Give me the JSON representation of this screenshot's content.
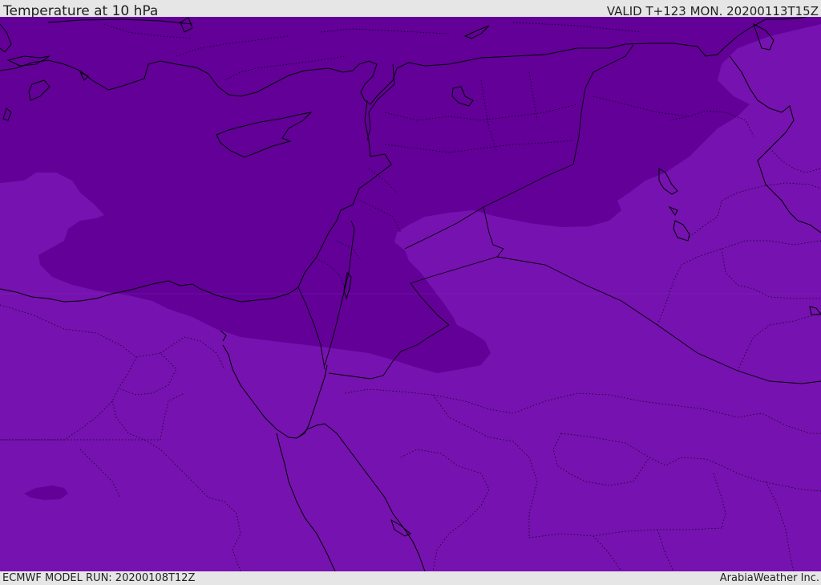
{
  "header": {
    "title": "Temperature at 10 hPa",
    "valid_time": "VALID T+123 MON. 20200113T15Z"
  },
  "footer": {
    "model_run": "ECMWF MODEL RUN: 20200108T12Z",
    "credit": "ArabiaWeather Inc."
  },
  "map": {
    "colors": {
      "warm_field": "#7612b0",
      "cold_field": "#620098",
      "coastline": "#000000",
      "border": "#000000"
    }
  }
}
